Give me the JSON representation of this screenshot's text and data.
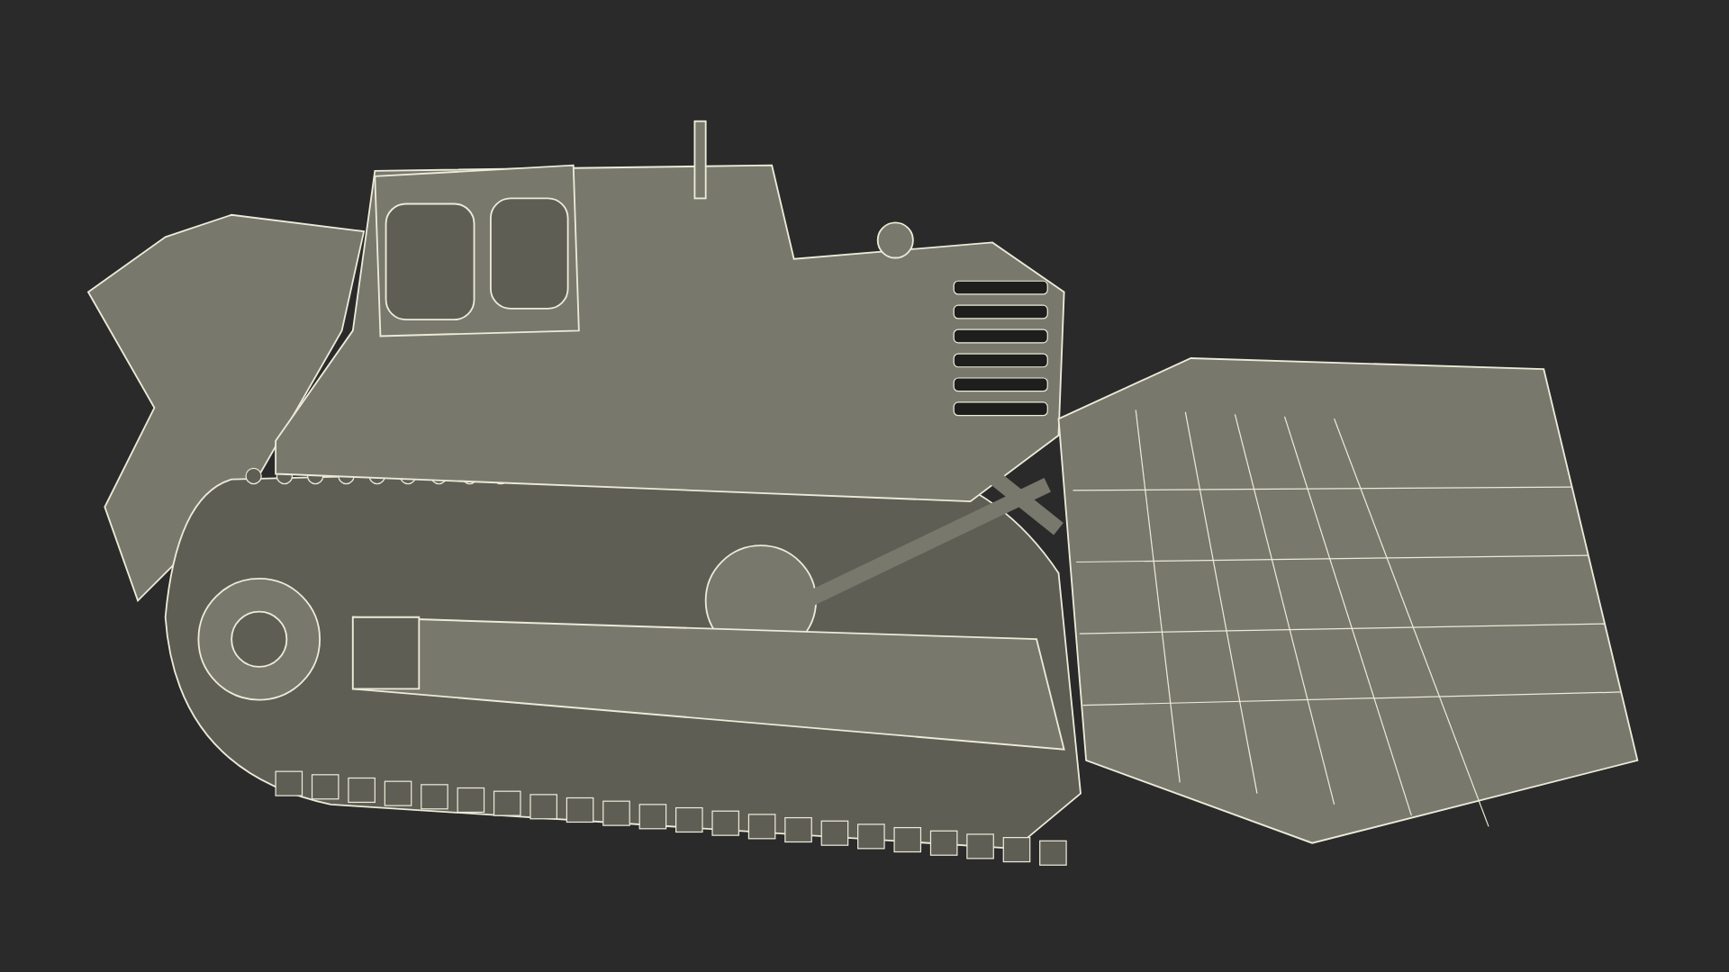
{
  "scene": {
    "kind": "bulldozer"
  }
}
